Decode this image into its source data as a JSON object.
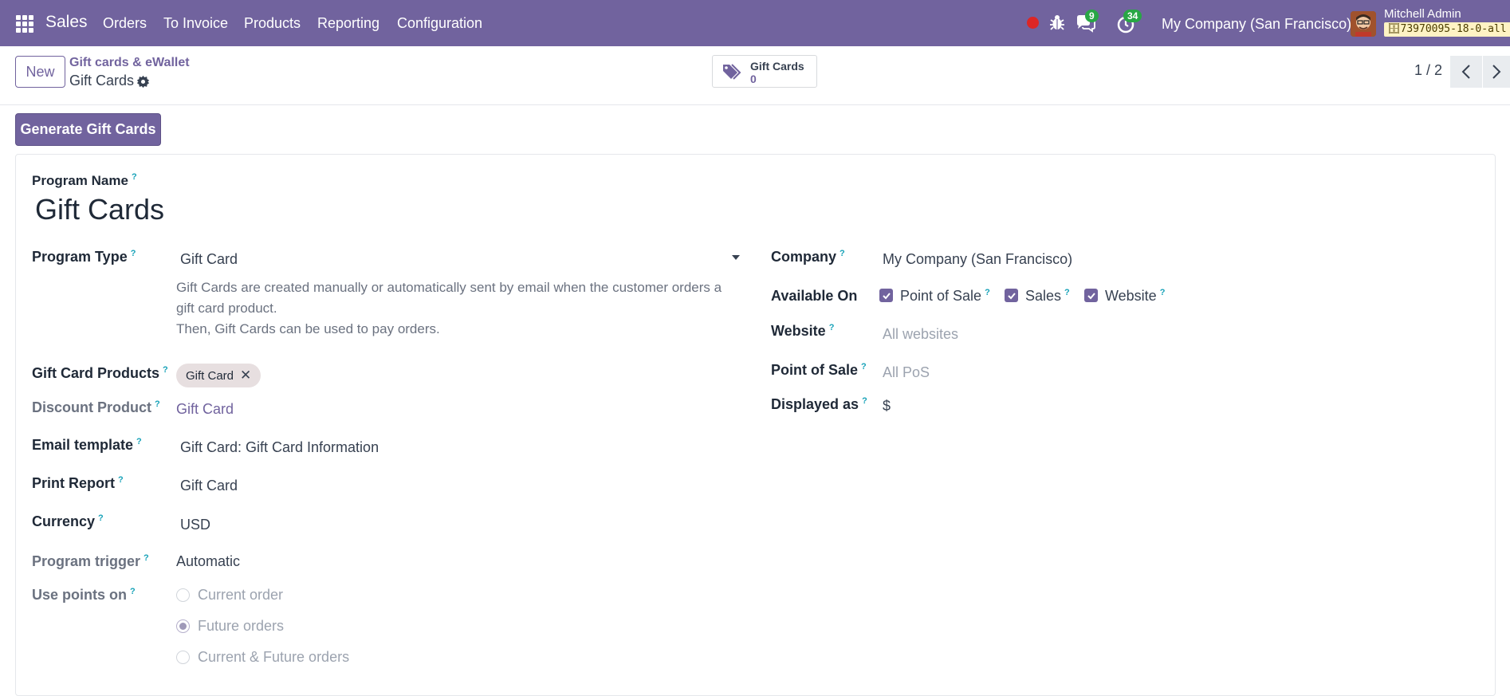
{
  "navbar": {
    "app_name": "Sales",
    "menu": [
      "Orders",
      "To Invoice",
      "Products",
      "Reporting",
      "Configuration"
    ],
    "messages_count": "9",
    "activities_count": "34",
    "company": "My Company (San Francisco)",
    "user_name": "Mitchell Admin",
    "database": "73970095-18-0-all"
  },
  "control_panel": {
    "new_label": "New",
    "breadcrumb_parent": "Gift cards & eWallet",
    "breadcrumb_current": "Gift Cards",
    "smart_button": {
      "label": "Gift Cards",
      "value": "0"
    },
    "pager": "1 / 2"
  },
  "actions": {
    "generate_label": "Generate Gift Cards"
  },
  "form": {
    "program_name_label": "Program Name",
    "program_name": "Gift Cards",
    "program_type_label": "Program Type",
    "program_type": "Gift Card",
    "program_type_desc": [
      "Gift Cards are created manually or automatically sent by email when the customer orders a",
      "gift card product.",
      "Then, Gift Cards can be used to pay orders."
    ],
    "gift_card_products_label": "Gift Card Products",
    "gift_card_products": [
      "Gift Card"
    ],
    "discount_product_label": "Discount Product",
    "discount_product": "Gift Card",
    "email_template_label": "Email template",
    "email_template": "Gift Card: Gift Card Information",
    "print_report_label": "Print Report",
    "print_report": "Gift Card",
    "currency_label": "Currency",
    "currency": "USD",
    "program_trigger_label": "Program trigger",
    "program_trigger": "Automatic",
    "use_points_label": "Use points on",
    "use_points_options": [
      "Current order",
      "Future orders",
      "Current & Future orders"
    ],
    "use_points_selected": "Future orders",
    "company_label": "Company",
    "company": "My Company (San Francisco)",
    "available_on_label": "Available On",
    "available_on": [
      {
        "label": "Point of Sale",
        "checked": true
      },
      {
        "label": "Sales",
        "checked": true
      },
      {
        "label": "Website",
        "checked": true
      }
    ],
    "website_label": "Website",
    "website_placeholder": "All websites",
    "pos_label": "Point of Sale",
    "pos_placeholder": "All PoS",
    "displayed_as_label": "Displayed as",
    "displayed_as": "$"
  },
  "colors": {
    "brand": "#71639e",
    "help": "#17a2b8",
    "badge": "#28a745"
  }
}
